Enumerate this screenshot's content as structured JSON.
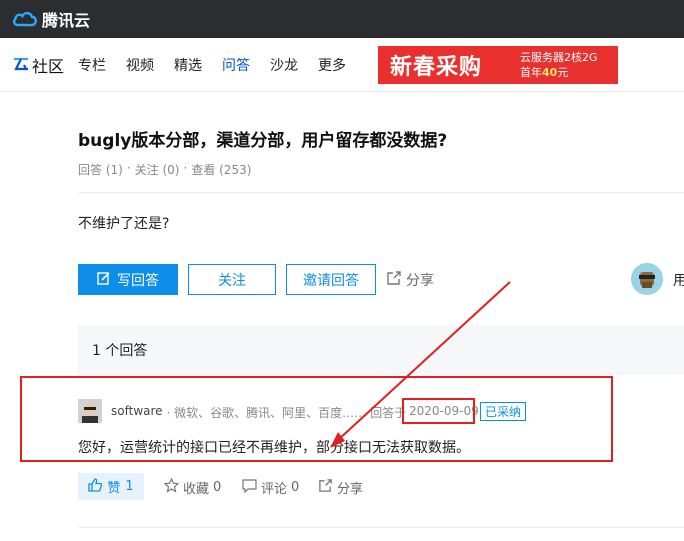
{
  "topbar": {
    "logo_text": "腾讯云"
  },
  "nav": {
    "brand_label": "社区",
    "items": [
      {
        "label": "专栏"
      },
      {
        "label": "视频"
      },
      {
        "label": "精选"
      },
      {
        "label": "问答",
        "active": true
      },
      {
        "label": "沙龙"
      },
      {
        "label": "更多"
      }
    ],
    "banner": {
      "big_text": "新春采购",
      "line1": "云服务器2核2G",
      "line2_prefix": "首年",
      "line2_price": "40",
      "line2_suffix": "元"
    }
  },
  "question": {
    "title": "bugly版本分部，渠道分部，用户留存都没数据?",
    "meta_answers": "回答 (1)",
    "meta_follow": "关注 (0)",
    "meta_views": "查看 (253)",
    "meta_sep": "·",
    "body": "不维护了还是?"
  },
  "actions": {
    "write_answer": "写回答",
    "follow": "关注",
    "invite": "邀请回答",
    "share": "分享",
    "right_text": "用"
  },
  "answers": {
    "header": "1 个回答",
    "items": [
      {
        "author": "software",
        "author_tags": "· 微软、谷歌、腾讯、阿里、百度……",
        "answered_at_label": "回答于",
        "date": "2020-09-09",
        "badge": "已采纳",
        "body": "您好，运营统计的接口已经不再维护，部分接口无法获取数据。",
        "like_label": "赞",
        "like_count": "1",
        "fav_label": "收藏",
        "fav_count": "0",
        "comment_label": "评论",
        "comment_count": "0",
        "share_label": "分享"
      }
    ]
  },
  "colors": {
    "topbar": "#2b2d31",
    "primary": "#0e8ee9",
    "annotation_red": "#e02020",
    "banner_red": "#e8312f"
  }
}
